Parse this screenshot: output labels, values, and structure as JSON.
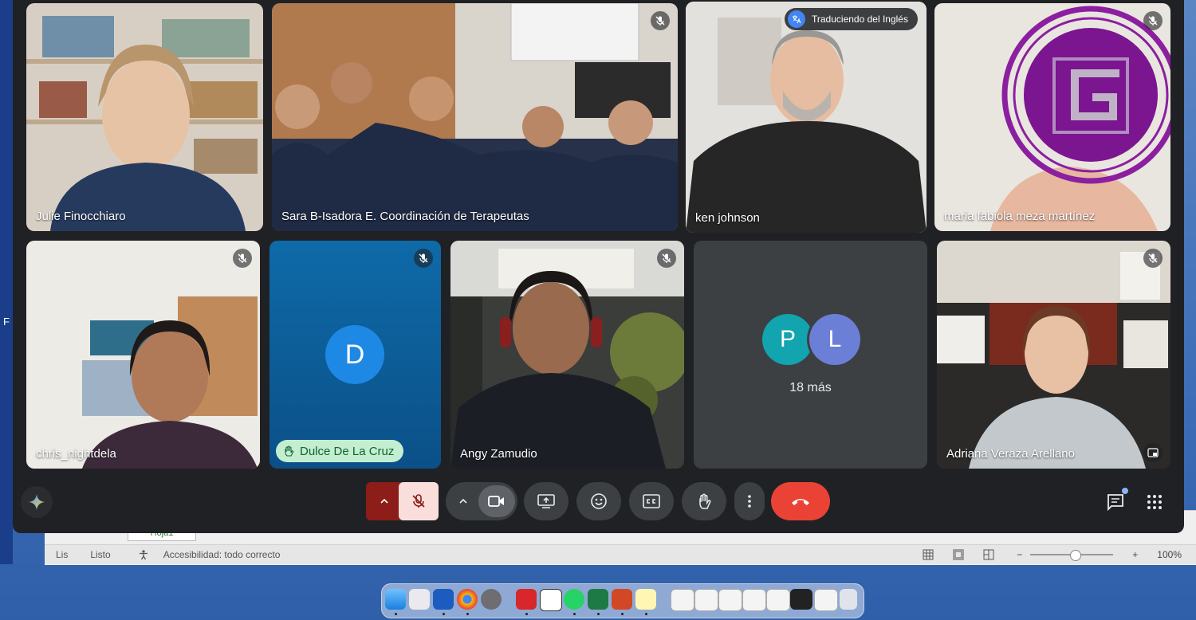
{
  "meet": {
    "participants": [
      {
        "name": "Julie Finocchiaro"
      },
      {
        "name": "Sara B-Isadora E. Coordinación de Terapeutas"
      },
      {
        "name": "ken johnson",
        "badge": "Traduciendo del Inglés"
      },
      {
        "name": "maria fabiola meza martínez"
      },
      {
        "name": "chris_nightdela"
      },
      {
        "name": "Dulce De La Cruz",
        "initial": "D"
      },
      {
        "name": "Angy Zamudio"
      },
      {
        "name": "Adriana Veraza Arellano"
      }
    ],
    "more": {
      "initials": [
        "P",
        "L"
      ],
      "label": "18 más"
    }
  },
  "excel": {
    "sheet_tab": "Hoja1",
    "status_left": "Lis",
    "status_ready": "Listo",
    "accessibility": "Accesibilidad: todo correcto",
    "zoom": "100%"
  },
  "desktop": {
    "edge_letter": "F"
  },
  "colors": {
    "meet_bg": "#202124",
    "tile_bg": "#3c4043",
    "end_call": "#ea4335",
    "mic_off_bg": "#f9dedc",
    "mic_arrow_bg": "#8c1d18",
    "hand_chip": "#c4eed0",
    "avatar_D": "#1e88e5",
    "avatar_P": "#12a4af",
    "avatar_L": "#6b7fd7",
    "speaking_ring": "#a8c7fa"
  },
  "icons": [
    "mic-off-icon",
    "camera-icon",
    "present-icon",
    "emoji-icon",
    "captions-icon",
    "raise-hand-icon",
    "more-vert-icon",
    "end-call-icon",
    "chat-icon",
    "apps-icon",
    "sparkle-icon",
    "translate-icon",
    "pip-icon"
  ]
}
